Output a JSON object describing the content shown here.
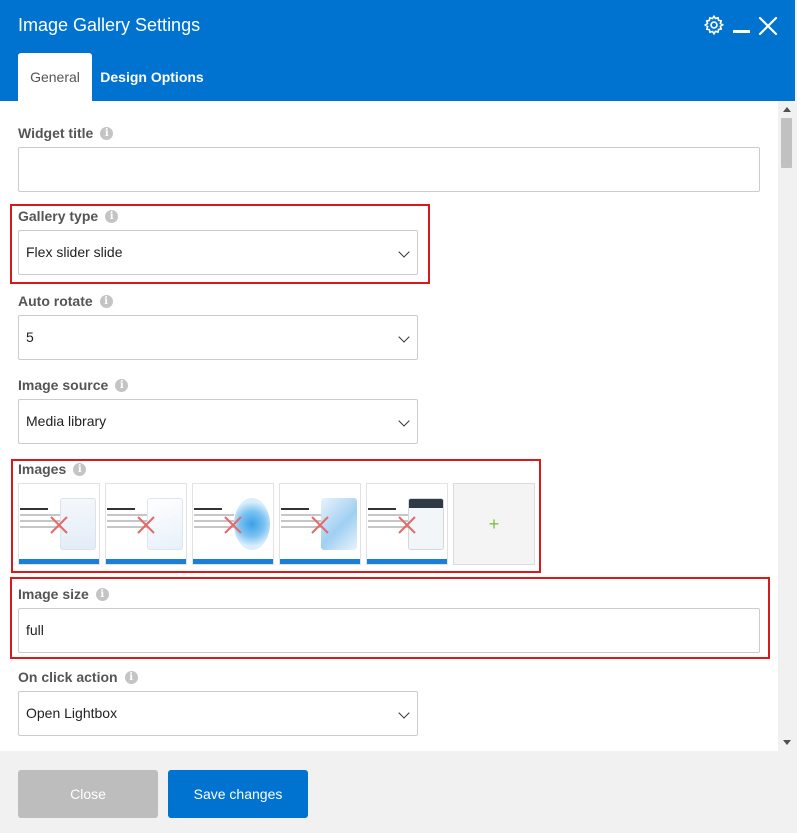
{
  "window": {
    "title": "Image Gallery Settings"
  },
  "tabs": [
    {
      "label": "General"
    },
    {
      "label": "Design Options"
    }
  ],
  "fields": {
    "widget_title": {
      "label": "Widget title",
      "value": ""
    },
    "gallery_type": {
      "label": "Gallery type",
      "value": "Flex slider slide"
    },
    "auto_rotate": {
      "label": "Auto rotate",
      "value": "5"
    },
    "image_source": {
      "label": "Image source",
      "value": "Media library"
    },
    "images": {
      "label": "Images",
      "count": 5,
      "add_symbol": "+"
    },
    "image_size": {
      "label": "Image size",
      "value": "full"
    },
    "on_click_action": {
      "label": "On click action",
      "value": "Open Lightbox"
    }
  },
  "info_icon_glyph": "i",
  "footer": {
    "close_label": "Close",
    "save_label": "Save changes"
  },
  "colors": {
    "accent": "#0073d1",
    "highlight": "#d71a1a",
    "add": "#7ac142",
    "remove": "#e46a6a"
  }
}
